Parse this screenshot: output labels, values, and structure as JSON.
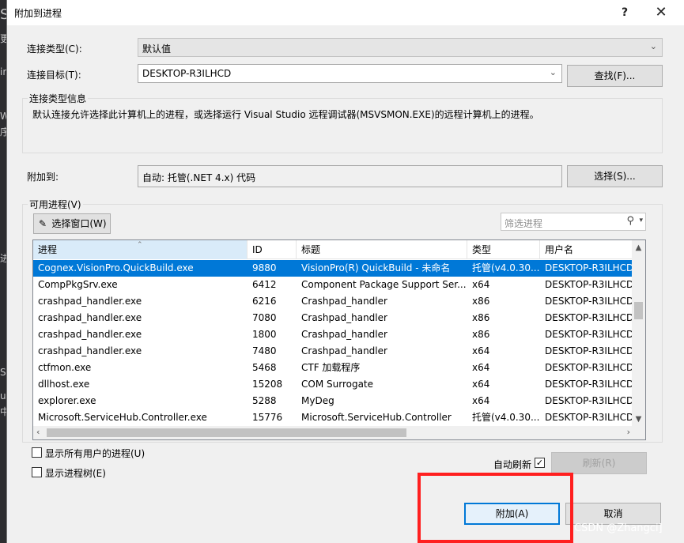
{
  "background": {
    "left_glyphs": [
      "S",
      "更",
      "ir",
      "W",
      "序",
      "进",
      "中",
      "SC",
      "u"
    ]
  },
  "dialog": {
    "title": "附加到进程",
    "help_label": "?",
    "close_label": "✕"
  },
  "connection": {
    "type_label": "连接类型(C):",
    "type_value": "默认值",
    "target_label": "连接目标(T):",
    "target_value": "DESKTOP-R3ILHCD",
    "find_button": "查找(F)...",
    "info_title": "连接类型信息",
    "info_text": "默认连接允许选择此计算机上的进程，或选择运行 Visual Studio 远程调试器(MSVSMON.EXE)的远程计算机上的进程。"
  },
  "attach_to": {
    "label": "附加到:",
    "value": "自动: 托管(.NET 4.x) 代码",
    "select_button": "选择(S)..."
  },
  "processes": {
    "group_title": "可用进程(V)",
    "select_window_button": "选择窗口(W)",
    "filter_placeholder": "筛选进程",
    "columns": [
      "进程",
      "ID",
      "标题",
      "类型",
      "用户名"
    ],
    "rows": [
      {
        "name": "Cognex.VisionPro.QuickBuild.exe",
        "id": "9880",
        "title": "VisionPro(R) QuickBuild - 未命名",
        "type": "托管(v4.0.30...",
        "user": "DESKTOP-R3ILHCD",
        "selected": true
      },
      {
        "name": "CompPkgSrv.exe",
        "id": "6412",
        "title": "Component Package Support Ser...",
        "type": "x64",
        "user": "DESKTOP-R3ILHCD"
      },
      {
        "name": "crashpad_handler.exe",
        "id": "6216",
        "title": "Crashpad_handler",
        "type": "x86",
        "user": "DESKTOP-R3ILHCD"
      },
      {
        "name": "crashpad_handler.exe",
        "id": "7080",
        "title": "Crashpad_handler",
        "type": "x86",
        "user": "DESKTOP-R3ILHCD"
      },
      {
        "name": "crashpad_handler.exe",
        "id": "1800",
        "title": "Crashpad_handler",
        "type": "x86",
        "user": "DESKTOP-R3ILHCD"
      },
      {
        "name": "crashpad_handler.exe",
        "id": "7480",
        "title": "Crashpad_handler",
        "type": "x64",
        "user": "DESKTOP-R3ILHCD"
      },
      {
        "name": "ctfmon.exe",
        "id": "5468",
        "title": "CTF 加载程序",
        "type": "x64",
        "user": "DESKTOP-R3ILHCD"
      },
      {
        "name": "dllhost.exe",
        "id": "15208",
        "title": "COM Surrogate",
        "type": "x64",
        "user": "DESKTOP-R3ILHCD"
      },
      {
        "name": "explorer.exe",
        "id": "5288",
        "title": "MyDeg",
        "type": "x64",
        "user": "DESKTOP-R3ILHCD"
      },
      {
        "name": "Microsoft.ServiceHub.Controller.exe",
        "id": "15776",
        "title": "Microsoft.ServiceHub.Controller",
        "type": "托管(v4.0.30...",
        "user": "DESKTOP-R3ILHCD"
      }
    ]
  },
  "options": {
    "show_all_users": "显示所有用户的进程(U)",
    "show_tree": "显示进程树(E)",
    "auto_refresh": "自动刷新",
    "auto_refresh_checked": "✓",
    "refresh_button": "刷新(R)"
  },
  "footer": {
    "attach_button": "附加(A)",
    "cancel_button": "取消"
  },
  "watermark": "CSDN @Zhangci]",
  "colors": {
    "selection": "#0078d7",
    "highlight_box": "#ff1f1f"
  }
}
